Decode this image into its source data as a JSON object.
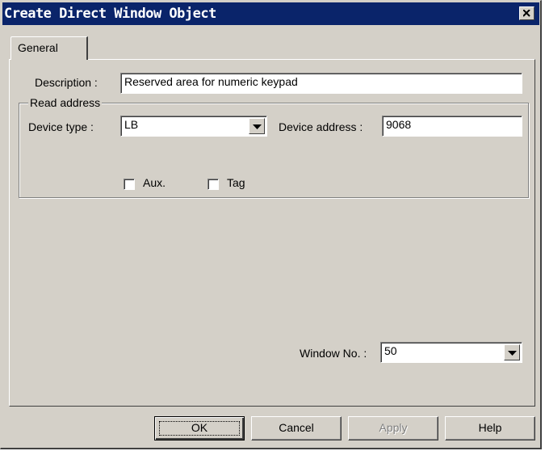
{
  "window": {
    "title": "Create Direct Window  Object"
  },
  "tabs": [
    {
      "label": "General"
    }
  ],
  "form": {
    "description_label": "Description :",
    "description_value": "Reserved area for numeric keypad",
    "read_address_group": "Read address",
    "device_type_label": "Device type :",
    "device_type_value": "LB",
    "device_address_label": "Device address :",
    "device_address_value": "9068",
    "aux_label": "Aux.",
    "aux_checked": false,
    "tag_label": "Tag",
    "tag_checked": false,
    "window_no_label": "Window No. :",
    "window_no_value": "50"
  },
  "buttons": {
    "ok": "OK",
    "cancel": "Cancel",
    "apply": "Apply",
    "help": "Help"
  },
  "colors": {
    "titlebar": "#0a246a",
    "face": "#d4d0c8",
    "field": "#ffffff"
  }
}
